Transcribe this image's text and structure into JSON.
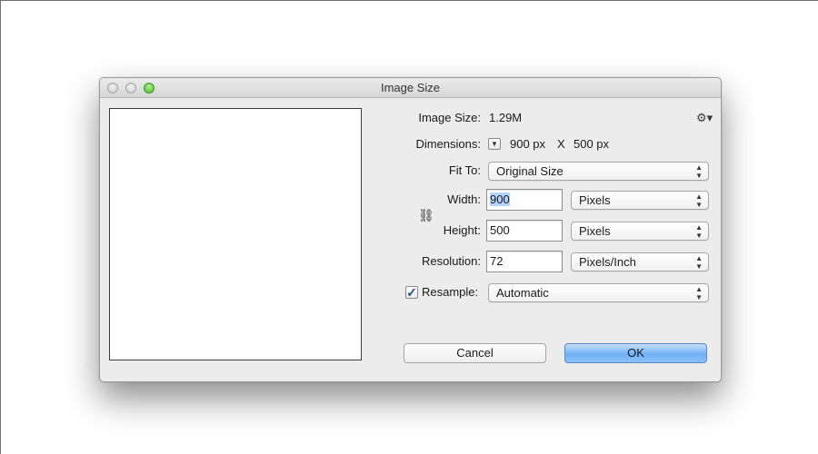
{
  "window": {
    "title": "Image Size"
  },
  "image_size": {
    "label": "Image Size:",
    "value": "1.29M"
  },
  "dimensions": {
    "label": "Dimensions:",
    "width": "900 px",
    "separator": "X",
    "height": "500 px"
  },
  "fit_to": {
    "label": "Fit To:",
    "selected": "Original Size"
  },
  "width": {
    "label": "Width:",
    "value": "900",
    "unit": "Pixels"
  },
  "height": {
    "label": "Height:",
    "value": "500",
    "unit": "Pixels"
  },
  "resolution": {
    "label": "Resolution:",
    "value": "72",
    "unit": "Pixels/Inch"
  },
  "resample": {
    "label": "Resample:",
    "checked": true,
    "selected": "Automatic"
  },
  "buttons": {
    "cancel": "Cancel",
    "ok": "OK"
  },
  "icons": {
    "settings": "gear-icon",
    "dimensions_menu": "disclosure-triangle-icon",
    "constrain": "chain-link-icon",
    "popup_arrows": "up-down-arrows-icon"
  },
  "colors": {
    "ok_button": "#6fb0f5",
    "selection_highlight": "#b3d4ff",
    "traffic_light_green": "#43b521"
  }
}
